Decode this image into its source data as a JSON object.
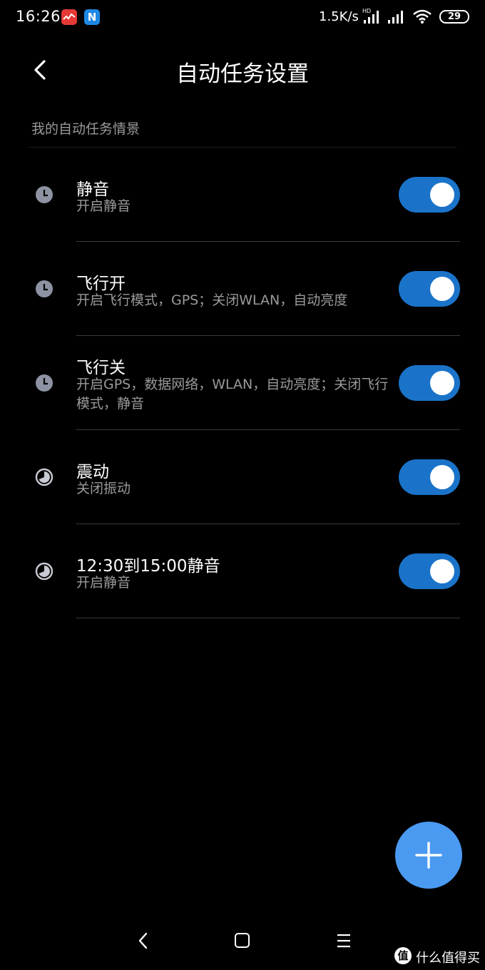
{
  "status_bar": {
    "time": "16:26",
    "network_speed": "1.5K/s",
    "hd_label": "HD",
    "battery": "29",
    "icons": [
      "stock-app-icon",
      "n-app-icon",
      "signal-hd-icon",
      "signal-icon",
      "wifi-icon",
      "battery-icon"
    ]
  },
  "header": {
    "title": "自动任务设置",
    "back_icon": "chevron-left-icon"
  },
  "section": {
    "label": "我的自动任务情景"
  },
  "tasks": [
    {
      "title": "静音",
      "description": "开启静音",
      "icon": "clock-icon",
      "enabled": true
    },
    {
      "title": "飞行开",
      "description": "开启飞行模式，GPS；关闭WLAN，自动亮度",
      "icon": "clock-icon",
      "enabled": true
    },
    {
      "title": "飞行关",
      "description": "开启GPS，数据网络，WLAN，自动亮度；关闭飞行模式，静音",
      "icon": "clock-icon",
      "enabled": true
    },
    {
      "title": "震动",
      "description": "关闭振动",
      "icon": "timer-icon",
      "enabled": true
    },
    {
      "title": "12:30到15:00静音",
      "description": "开启静音",
      "icon": "timer-icon",
      "enabled": true
    }
  ],
  "fab": {
    "icon": "plus-icon"
  },
  "nav_bar": {
    "icons": [
      "nav-back-icon",
      "nav-home-icon",
      "nav-menu-icon"
    ]
  },
  "watermark": {
    "logo": "值",
    "text": "什么值得买"
  },
  "colors": {
    "background": "#000000",
    "toggle_on": "#1a73c9",
    "fab": "#4a9af2",
    "secondary_text": "#9a9a9a"
  }
}
